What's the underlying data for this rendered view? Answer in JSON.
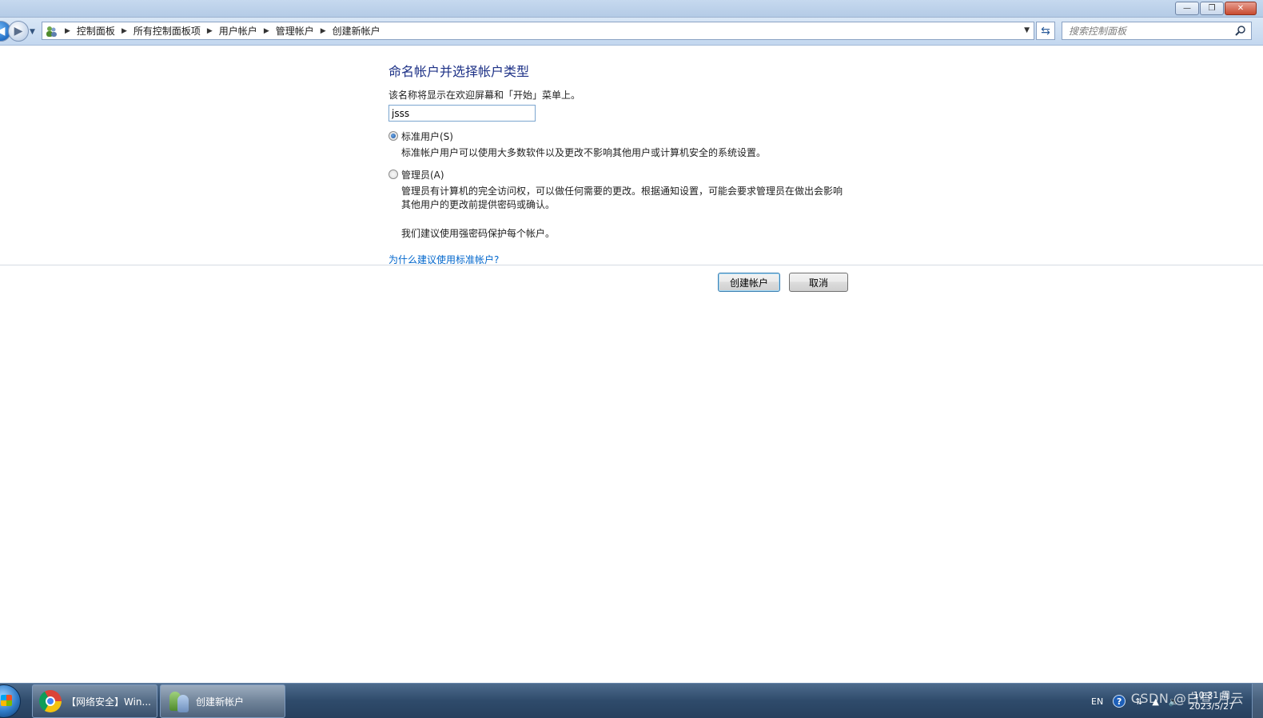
{
  "window": {
    "buttons": {
      "minimize": "—",
      "restore": "❐",
      "close": "✕"
    }
  },
  "address_bar": {
    "breadcrumbs": [
      "控制面板",
      "所有控制面板项",
      "用户帐户",
      "管理帐户",
      "创建新帐户"
    ],
    "search_placeholder": "搜索控制面板"
  },
  "content": {
    "heading": "命名帐户并选择帐户类型",
    "description": "该名称将显示在欢迎屏幕和「开始」菜单上。",
    "name_value": "jsss",
    "options": [
      {
        "label": "标准用户(S)",
        "selected": true,
        "description": "标准帐户用户可以使用大多数软件以及更改不影响其他用户或计算机安全的系统设置。"
      },
      {
        "label": "管理员(A)",
        "selected": false,
        "description": "管理员有计算机的完全访问权，可以做任何需要的更改。根据通知设置，可能会要求管理员在做出会影响其他用户的更改前提供密码或确认。"
      }
    ],
    "tip": "我们建议使用强密码保护每个帐户。",
    "why_link": "为什么建议使用标准帐户?"
  },
  "buttons": {
    "create": "创建帐户",
    "cancel": "取消"
  },
  "taskbar": {
    "items": [
      {
        "label": "【网络安全】Win...",
        "icon": "chrome-icon"
      },
      {
        "label": "创建新帐户",
        "icon": "user-accounts-icon",
        "active": true
      }
    ],
    "tray": {
      "language": "EN",
      "time": "10:31 周",
      "date": "2023/5/27"
    },
    "watermark": "CSDN @白昼 月云"
  },
  "colors": {
    "heading": "#1e3287",
    "link": "#0066cc",
    "taskbar": "#2f4b6b"
  }
}
